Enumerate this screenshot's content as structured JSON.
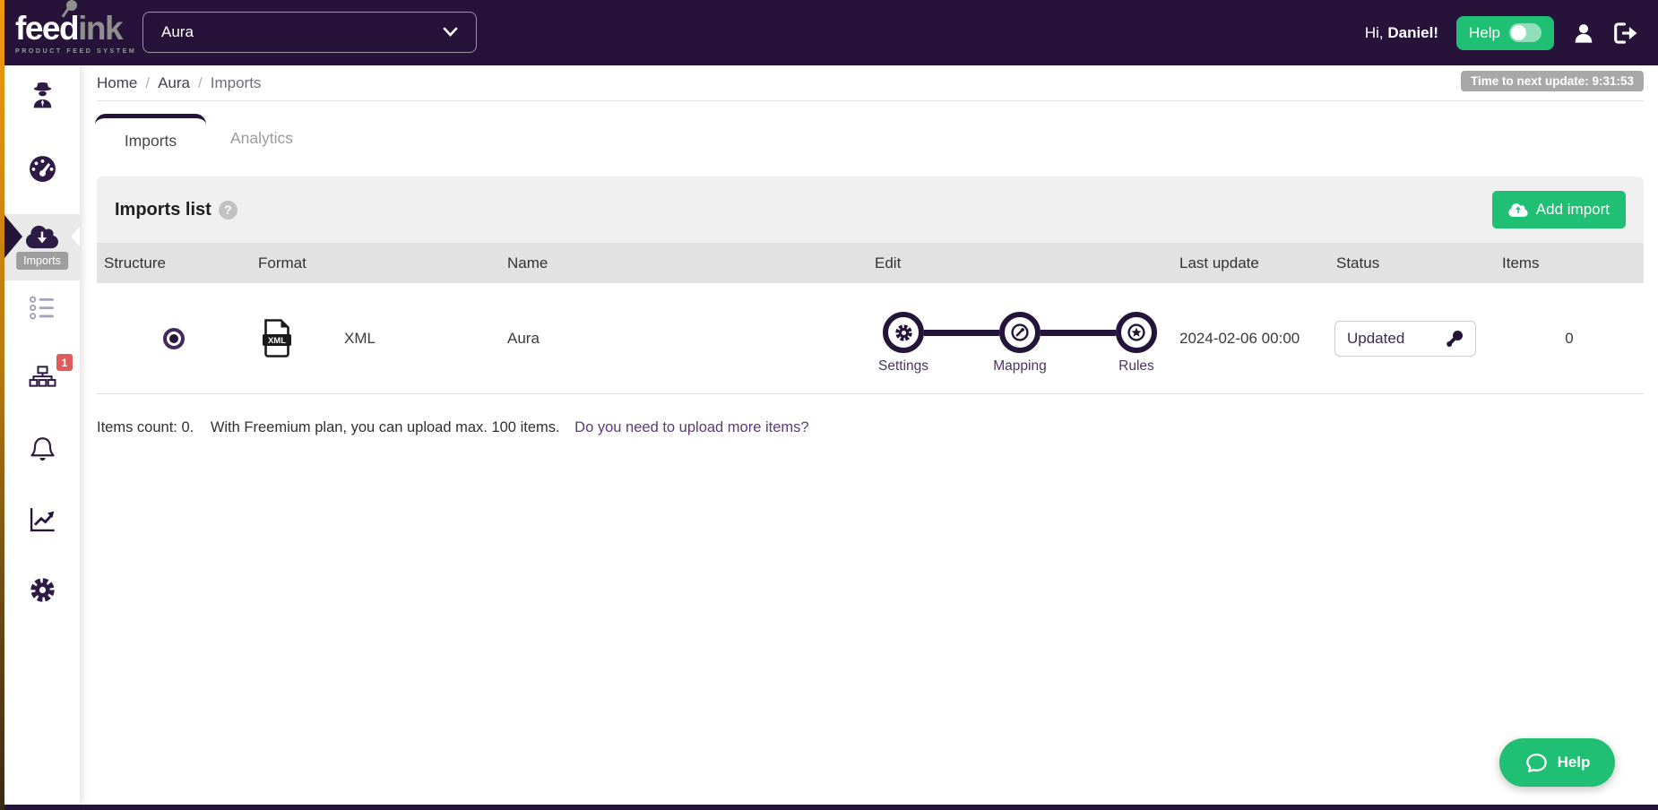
{
  "header": {
    "logo": {
      "part1": "feed",
      "part2": "ink",
      "tagline": "PRODUCT FEED SYSTEM"
    },
    "project_select": {
      "value": "Aura"
    },
    "greeting_prefix": "Hi,",
    "greeting_name": "Daniel!",
    "help_button": "Help"
  },
  "sidebar": {
    "imports_tooltip": "Imports",
    "structure_badge": "1"
  },
  "breadcrumb": {
    "home": "Home",
    "separator": "/",
    "project": "Aura",
    "current": "Imports"
  },
  "update_timer": "Time to next update: 9:31:53",
  "tabs": {
    "imports": "Imports",
    "analytics": "Analytics"
  },
  "panel": {
    "title": "Imports list",
    "add_button": "Add import"
  },
  "table": {
    "columns": [
      "Structure",
      "Format",
      "Name",
      "Edit",
      "Last update",
      "Status",
      "Items"
    ],
    "rows": [
      {
        "format_icon_label": "XML",
        "format": "XML",
        "name": "Aura",
        "edit_steps": [
          "Settings",
          "Mapping",
          "Rules"
        ],
        "last_update": "2024-02-06 00:00",
        "status": "Updated",
        "items": "0"
      }
    ]
  },
  "footer_note": {
    "count": "Items count: 0.",
    "plan": "With Freemium plan, you can upload max. 100 items.",
    "link": "Do you need to upload more items?"
  },
  "help_launcher": "Help",
  "colors": {
    "accent_green": "#1fbf74",
    "dark_purple": "#241439",
    "badge_red": "#e05c5c",
    "strip_orange": "#f09a12"
  }
}
